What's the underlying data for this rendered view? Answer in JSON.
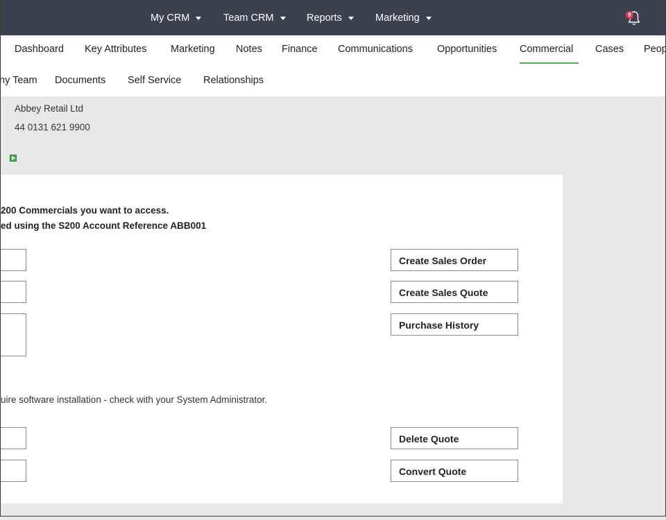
{
  "topnav": {
    "items": [
      {
        "label": "My CRM"
      },
      {
        "label": "Team CRM"
      },
      {
        "label": "Reports"
      },
      {
        "label": "Marketing"
      }
    ],
    "notification_count": "9"
  },
  "tabs": {
    "row1": [
      "Dashboard",
      "Key Attributes",
      "Marketing",
      "Notes",
      "Finance",
      "Communications",
      "Opportunities",
      "Commercial",
      "Cases",
      "Peop"
    ],
    "row2": [
      "ny Team",
      "Documents",
      "Self Service",
      "Relationships"
    ],
    "active": "Commercial"
  },
  "account": {
    "name": "Abbey Retail Ltd",
    "phone": "44 0131 621 9900"
  },
  "panel": {
    "instruction_line1": "200 Commercials you want to access.",
    "instruction_line2": "ed using the S200 Account Reference ABB001",
    "software_note": "uire software installation - check with your System Administrator.",
    "buttons": {
      "create_sales_order": "Create Sales Order",
      "create_sales_quote": "Create Sales Quote",
      "purchase_history": "Purchase History",
      "delete_quote": "Delete Quote",
      "convert_quote": "Convert Quote"
    }
  },
  "colors": {
    "topbar": "#3c414e",
    "active_tab_underline": "#4caf50",
    "badge": "#e8344e"
  }
}
